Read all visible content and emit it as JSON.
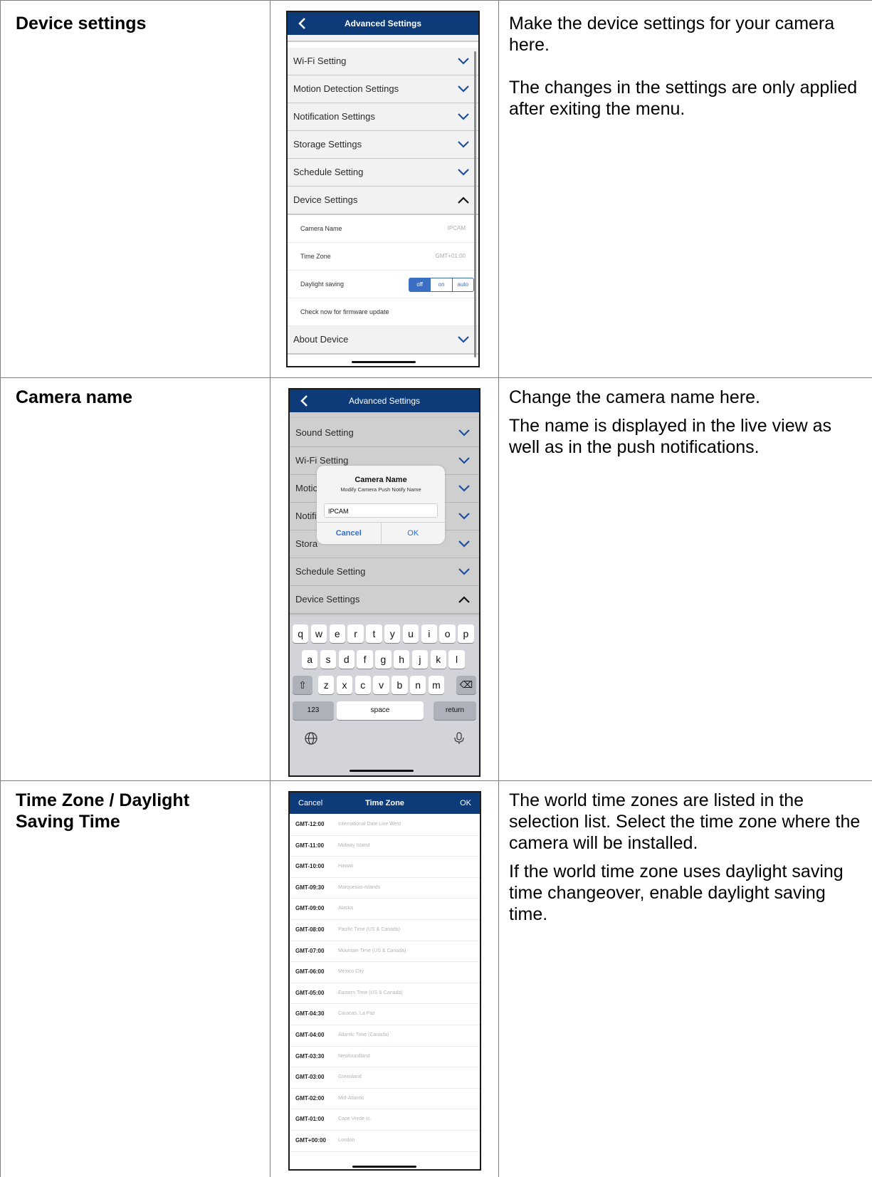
{
  "rows": [
    {
      "label": "Device settings",
      "description": [
        "Make the device settings for your camera here.",
        "The changes in the settings are only applied after exiting the menu."
      ]
    },
    {
      "label": "Camera name",
      "description": [
        "Change the camera name here.",
        "The name is displayed in the live view as well as in the push notifications."
      ]
    },
    {
      "label": "Time Zone / Daylight Saving Time",
      "description": [
        "The world time zones are listed in the selection list. Select the time zone where the camera will be installed.",
        "If the world time zone uses daylight saving time changeover, enable daylight saving time."
      ]
    }
  ],
  "screen1": {
    "title": "Advanced Settings",
    "items": [
      "Wi-Fi Setting",
      "Motion Detection Settings",
      "Notification Settings",
      "Storage Settings",
      "Schedule Setting",
      "Device Settings"
    ],
    "sub": {
      "camera_name_label": "Camera Name",
      "camera_name_value": "IPCAM",
      "time_zone_label": "Time Zone",
      "time_zone_value": "GMT+01:00",
      "daylight_label": "Daylight saving",
      "daylight_options": [
        "off",
        "on",
        "auto"
      ],
      "firmware_label": "Check now for firmware update"
    },
    "last_item": "About Device"
  },
  "screen2": {
    "title": "Advanced Settings",
    "items": [
      "Sound Setting",
      "Wi-Fi Setting",
      "Motic",
      "Notifi",
      "Stora",
      "Schedule Setting",
      "Device Settings"
    ],
    "dialog": {
      "title": "Camera Name",
      "subtitle": "Modify Camera Push Notify Name",
      "input_value": "IPCAM",
      "cancel": "Cancel",
      "ok": "OK"
    },
    "keyboard": {
      "row1": [
        "q",
        "w",
        "e",
        "r",
        "t",
        "y",
        "u",
        "i",
        "o",
        "p"
      ],
      "row2": [
        "a",
        "s",
        "d",
        "f",
        "g",
        "h",
        "j",
        "k",
        "l"
      ],
      "row3": [
        "z",
        "x",
        "c",
        "v",
        "b",
        "n",
        "m"
      ],
      "numbers": "123",
      "space": "space",
      "return": "return"
    }
  },
  "screen3": {
    "cancel": "Cancel",
    "title": "Time Zone",
    "ok": "OK",
    "zones": [
      {
        "code": "GMT-12:00",
        "city": "International Date Line West"
      },
      {
        "code": "GMT-11:00",
        "city": "Midway Island"
      },
      {
        "code": "GMT-10:00",
        "city": "Hawaii"
      },
      {
        "code": "GMT-09:30",
        "city": "Marquesas-Islands"
      },
      {
        "code": "GMT-09:00",
        "city": "Alaska"
      },
      {
        "code": "GMT-08:00",
        "city": "Pacific Time (US & Canada)"
      },
      {
        "code": "GMT-07:00",
        "city": "Mountain Time (US & Canada)"
      },
      {
        "code": "GMT-06:00",
        "city": "Mexico City"
      },
      {
        "code": "GMT-05:00",
        "city": "Eastern Time (US & Canada)"
      },
      {
        "code": "GMT-04:30",
        "city": "Caracas, La Paz"
      },
      {
        "code": "GMT-04:00",
        "city": "Atlantic Time (Canada)"
      },
      {
        "code": "GMT-03:30",
        "city": "Newfoundland"
      },
      {
        "code": "GMT-03:00",
        "city": "Greenland"
      },
      {
        "code": "GMT-02:00",
        "city": "Mid-Atlantic"
      },
      {
        "code": "GMT-01:00",
        "city": "Cape Verde Is."
      },
      {
        "code": "GMT+00:00",
        "city": "London"
      }
    ]
  }
}
